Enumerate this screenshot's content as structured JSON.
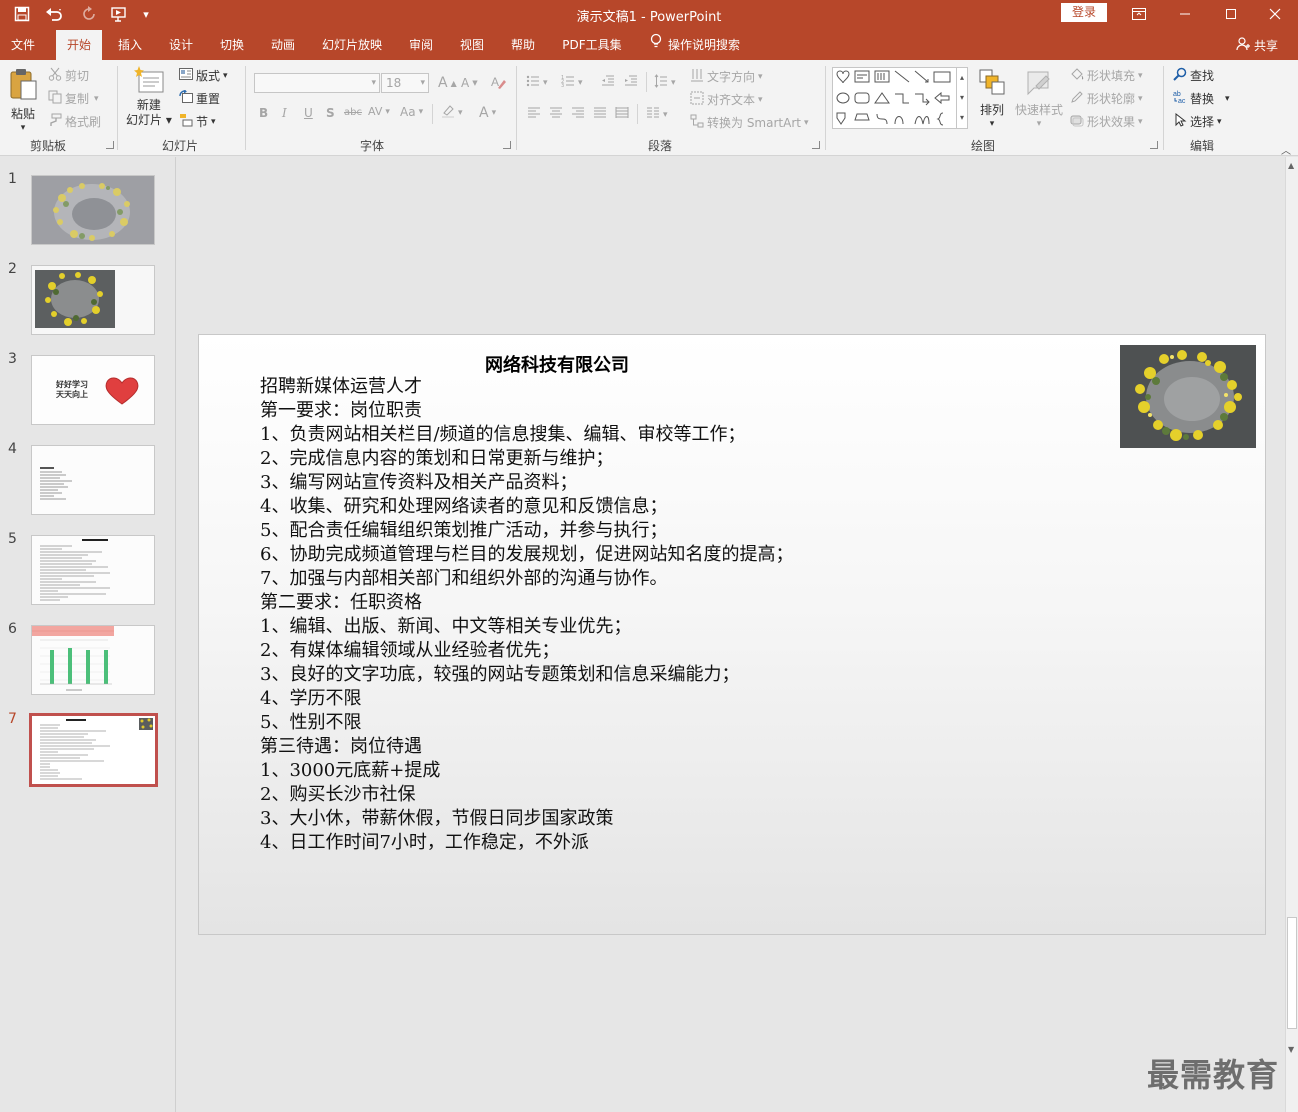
{
  "titlebar": {
    "title": "演示文稿1  -  PowerPoint",
    "login": "登录",
    "icons": [
      "save-icon",
      "undo-icon",
      "redo-icon",
      "from-beginning-icon",
      "customize-icon"
    ]
  },
  "menu": {
    "tabs": [
      "文件",
      "开始",
      "插入",
      "设计",
      "切换",
      "动画",
      "幻灯片放映",
      "审阅",
      "视图",
      "帮助",
      "PDF工具集"
    ],
    "active_tab": "开始",
    "tell_me": "操作说明搜索",
    "share": "共享"
  },
  "ribbon": {
    "clipboard": {
      "label": "剪贴板",
      "paste": "粘贴",
      "cut": "剪切",
      "copy": "复制",
      "format_painter": "格式刷"
    },
    "slides": {
      "label": "幻灯片",
      "new_slide_line1": "新建",
      "new_slide_line2": "幻灯片",
      "layout": "版式",
      "reset": "重置",
      "section": "节"
    },
    "font": {
      "label": "字体",
      "font_name": "",
      "font_size": "18",
      "grow": "A",
      "shrink": "A",
      "bold": "B",
      "italic": "I",
      "underline": "U",
      "shadow": "S",
      "strike": "abc",
      "spacing": "AV",
      "case": "Aa",
      "color": "A"
    },
    "paragraph": {
      "label": "段落",
      "text_direction": "文字方向",
      "align_text": "对齐文本",
      "smartart": "转换为 SmartArt"
    },
    "drawing": {
      "label": "绘图",
      "arrange": "排列",
      "quick_styles": "快速样式",
      "shape_fill": "形状填充",
      "shape_outline": "形状轮廓",
      "shape_effects": "形状效果"
    },
    "editing": {
      "label": "编辑",
      "find": "查找",
      "replace": "替换",
      "select": "选择"
    }
  },
  "thumbnails": {
    "numbers": [
      "1",
      "2",
      "3",
      "4",
      "5",
      "6",
      "7"
    ],
    "active": "7",
    "slide3_line1": "好好学习",
    "slide3_line2": "天天向上"
  },
  "slide": {
    "title": "网络科技有限公司",
    "lines": [
      "招聘新媒体运营人才",
      "第一要求：岗位职责",
      "1、负责网站相关栏目/频道的信息搜集、编辑、审校等工作；",
      "2、完成信息内容的策划和日常更新与维护；",
      "3、编写网站宣传资料及相关产品资料；",
      "4、收集、研究和处理网络读者的意见和反馈信息；",
      "5、配合责任编辑组织策划推广活动，并参与执行；",
      "6、协助完成频道管理与栏目的发展规划，促进网站知名度的提高；",
      "7、加强与内部相关部门和组织外部的沟通与协作。",
      "第二要求：任职资格",
      "1、编辑、出版、新闻、中文等相关专业优先；",
      "2、有媒体编辑领域从业经验者优先；",
      "3、良好的文字功底，较强的网站专题策划和信息采编能力；",
      "4、学历不限",
      "5、性别不限",
      "第三待遇：岗位待遇",
      "1、3000元底薪+提成",
      "2、购买长沙市社保",
      "3、大小休，带薪休假，节假日同步国家政策",
      "4、日工作时间7小时，工作稳定，不外派"
    ]
  },
  "watermark": "最需教育",
  "colors": {
    "accent": "#b7472a",
    "active_thumb": "#c0504d",
    "ribbon_bg": "#f3f3f3",
    "workspace": "#e6e6e6"
  }
}
